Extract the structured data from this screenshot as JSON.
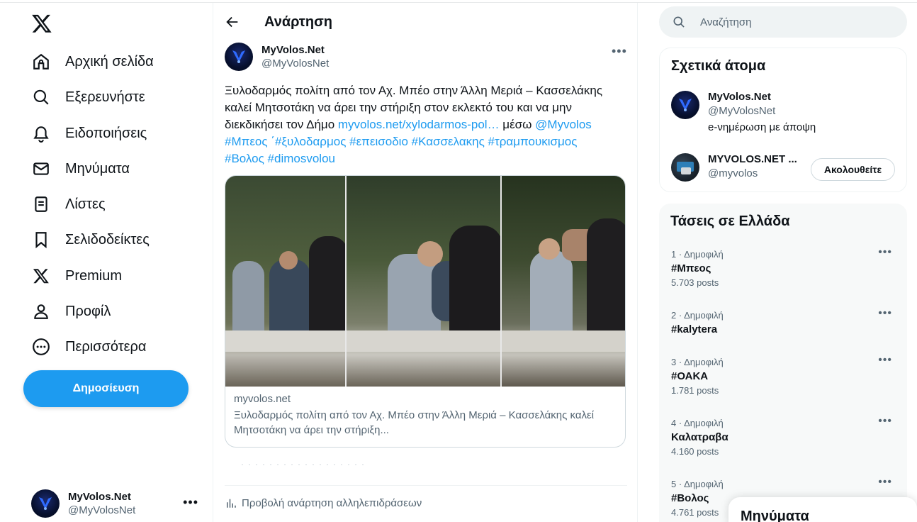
{
  "nav": {
    "items": [
      {
        "label": "Αρχική σελίδα",
        "icon": "home-icon"
      },
      {
        "label": "Εξερευνήστε",
        "icon": "search-icon"
      },
      {
        "label": "Ειδοποιήσεις",
        "icon": "bell-icon"
      },
      {
        "label": "Μηνύματα",
        "icon": "mail-icon"
      },
      {
        "label": "Λίστες",
        "icon": "list-icon"
      },
      {
        "label": "Σελιδοδείκτες",
        "icon": "bookmark-icon"
      },
      {
        "label": "Premium",
        "icon": "x-logo-icon"
      },
      {
        "label": "Προφίλ",
        "icon": "person-icon"
      },
      {
        "label": "Περισσότερα",
        "icon": "more-circle-icon"
      }
    ],
    "post_button": "Δημοσίευση",
    "account": {
      "name": "MyVolos.Net",
      "handle": "@MyVolosNet"
    }
  },
  "main": {
    "header_title": "Ανάρτηση",
    "post": {
      "author_name": "MyVolos.Net",
      "author_handle": "@MyVolosNet",
      "text_line1": "Ξυλοδαρμός πολίτη από τον Αχ. Μπέο στην Άλλη Μεριά – Κασσελάκης",
      "text_line2": "καλεί Μητσοτάκη να άρει την στήριξη στον εκλεκτό του και να μην",
      "text_line3_plain": "διεκδικήσει τον Δήμο ",
      "text_link": "myvolos.net/xylodarmos-pol…",
      "text_via": " μέσω ",
      "text_mention": "@Myvolos",
      "hashtags_line1": "#Μπεος ΄#ξυλοδαρμος #επεισοδιο #Κασσελακης #τραμπουκισμος",
      "hashtags_line2": "#Βολος #dimosvolou",
      "card_domain": "myvolos.net",
      "card_title_line1": "Ξυλοδαρμός πολίτη από τον Αχ. Μπέο στην Άλλη Μεριά – Κασσελάκης καλεί",
      "card_title_line2": "Μητσοτάκη να άρει την στήριξη..."
    },
    "engagements_label": "Προβολή ανάρτηση αλληλεπιδράσεων"
  },
  "right": {
    "search_placeholder": "Αναζήτηση",
    "related": {
      "title": "Σχετικά άτομα",
      "people": [
        {
          "name": "MyVolos.Net",
          "handle": "@MyVolosNet",
          "bio": "e-νημέρωση με άποψη"
        },
        {
          "name": "MYVOLOS.NET ...",
          "handle": "@myvolos",
          "follow": "Ακολουθείτε"
        }
      ]
    },
    "trends": {
      "title": "Τάσεις σε Ελλάδα",
      "items": [
        {
          "meta": "1 · Δημοφιλή",
          "name": "#Μπεος",
          "count": "5.703 posts"
        },
        {
          "meta": "2 · Δημοφιλή",
          "name": "#kalytera",
          "count": ""
        },
        {
          "meta": "3 · Δημοφιλή",
          "name": "#ΟΑΚΑ",
          "count": "1.781 posts"
        },
        {
          "meta": "4 · Δημοφιλή",
          "name": "Καλατραβα",
          "count": "4.160 posts"
        },
        {
          "meta": "5 · Δημοφιλή",
          "name": "#Βολος",
          "count": "4.761 posts"
        }
      ]
    },
    "messages_drawer": "Μηνύματα"
  },
  "colors": {
    "accent": "#1d9bf0",
    "text": "#0f1419",
    "muted": "#536471"
  }
}
